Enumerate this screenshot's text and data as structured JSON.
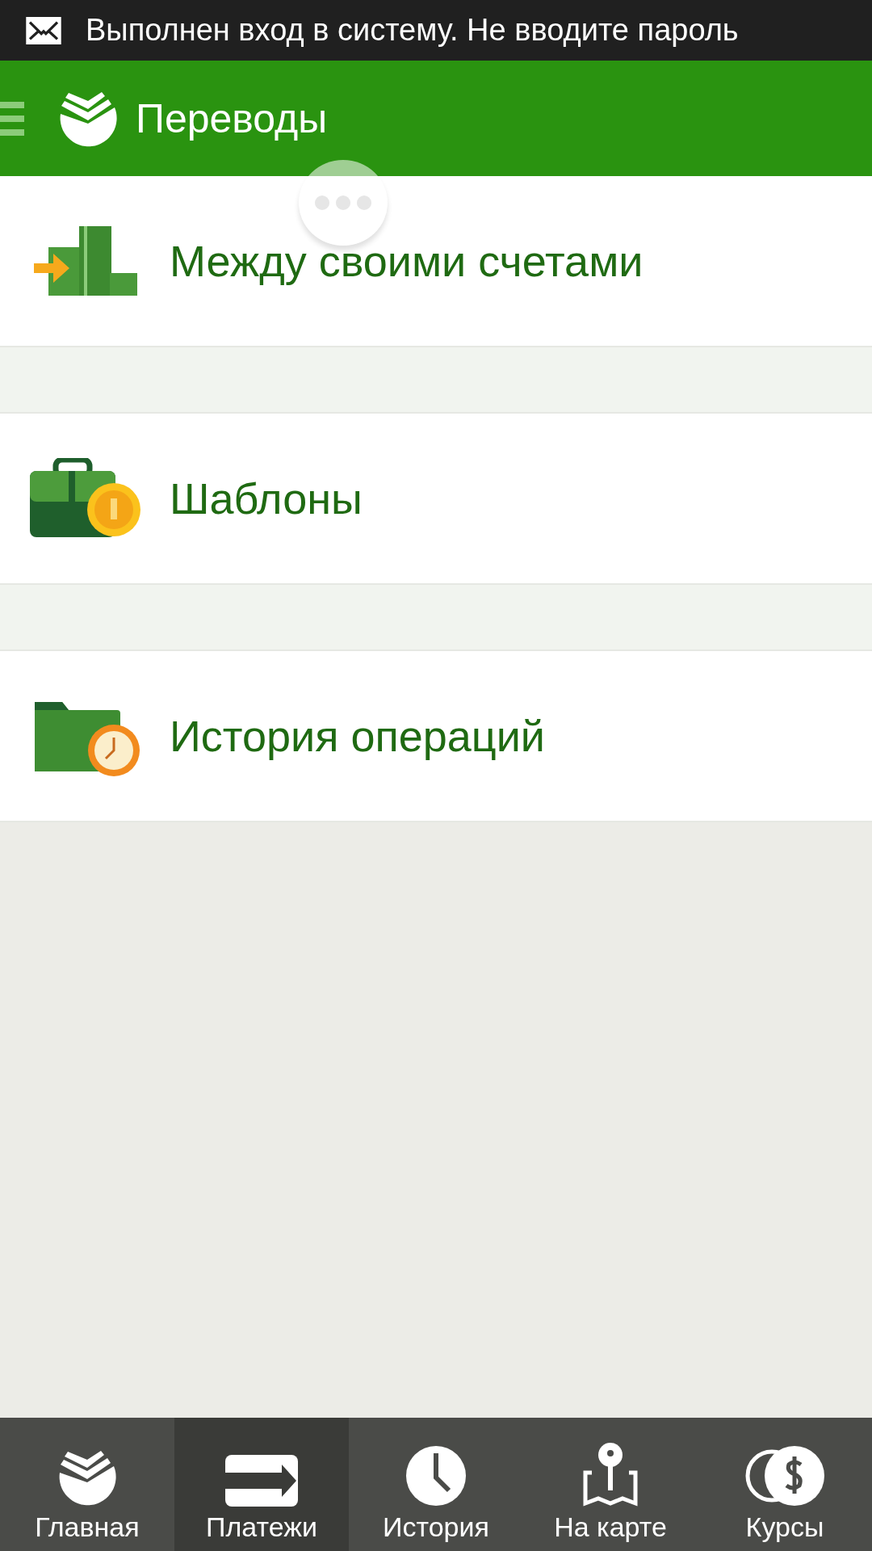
{
  "status_bar": {
    "notification": "Выполнен вход в систему. Не вводите пароль"
  },
  "header": {
    "title": "Переводы"
  },
  "menu_items": [
    {
      "kind": "transfer",
      "label": "Между своими счетами"
    },
    {
      "kind": "templates",
      "label": "Шаблоны"
    },
    {
      "kind": "history",
      "label": "История операций"
    }
  ],
  "bottom_nav": [
    {
      "kind": "home",
      "label": "Главная",
      "selected": false
    },
    {
      "kind": "payments",
      "label": "Платежи",
      "selected": true
    },
    {
      "kind": "history",
      "label": "История",
      "selected": false
    },
    {
      "kind": "map",
      "label": "На карте",
      "selected": false
    },
    {
      "kind": "rates",
      "label": "Курсы",
      "selected": false
    }
  ]
}
